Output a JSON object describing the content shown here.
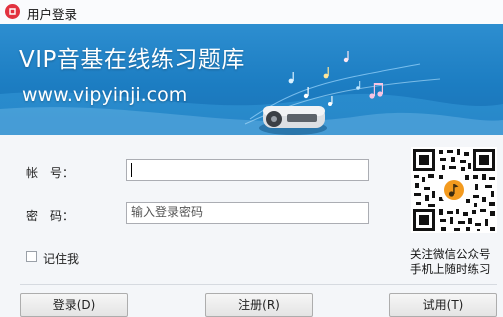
{
  "window": {
    "title": "用户登录"
  },
  "banner": {
    "title": "VIP音基在线练习题库",
    "url": "www.vipyinji.com"
  },
  "form": {
    "account_label": "帐　号：",
    "account_value": "",
    "password_label": "密　码：",
    "password_placeholder": "输入登录密码",
    "remember_label": "记住我",
    "remember_checked": false
  },
  "qr": {
    "caption_line1": "关注微信公众号",
    "caption_line2": "手机上随时练习"
  },
  "buttons": {
    "login": "登录(D)",
    "register": "注册(R)",
    "trial": "试用(T)"
  },
  "colors": {
    "banner_blue": "#1c7dc2",
    "brand_red": "#e2323f",
    "qr_badge": "#f39a1e"
  }
}
